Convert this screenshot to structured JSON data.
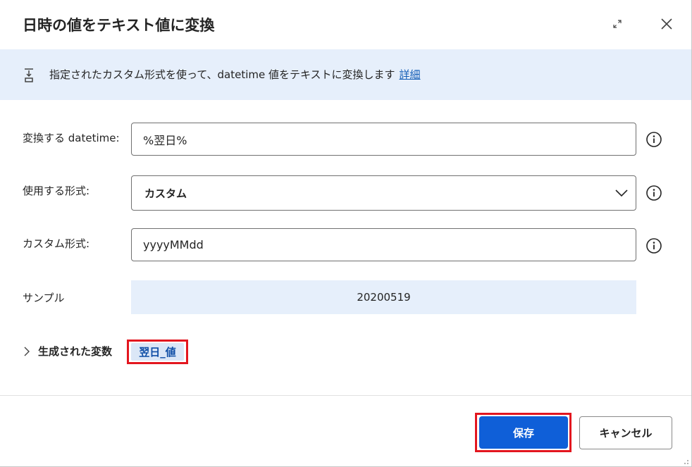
{
  "dialog": {
    "title": "日時の値をテキスト値に変換"
  },
  "banner": {
    "text": "指定されたカスタム形式を使って、datetime 値をテキストに変換します",
    "link": "詳細"
  },
  "fields": {
    "datetime_label": "変換する datetime:",
    "datetime_value": "%翌日%",
    "format_label": "使用する形式:",
    "format_value": "カスタム",
    "custom_label": "カスタム形式:",
    "custom_value": "yyyyMMdd",
    "sample_label": "サンプル",
    "sample_value": "20200519"
  },
  "generated": {
    "label": "生成された変数",
    "variable": "翌日_値"
  },
  "footer": {
    "save": "保存",
    "cancel": "キャンセル"
  },
  "colors": {
    "primary": "#0f5fd8",
    "highlight": "#e3161f",
    "banner_bg": "#e6effb",
    "link": "#0f5bb5"
  }
}
